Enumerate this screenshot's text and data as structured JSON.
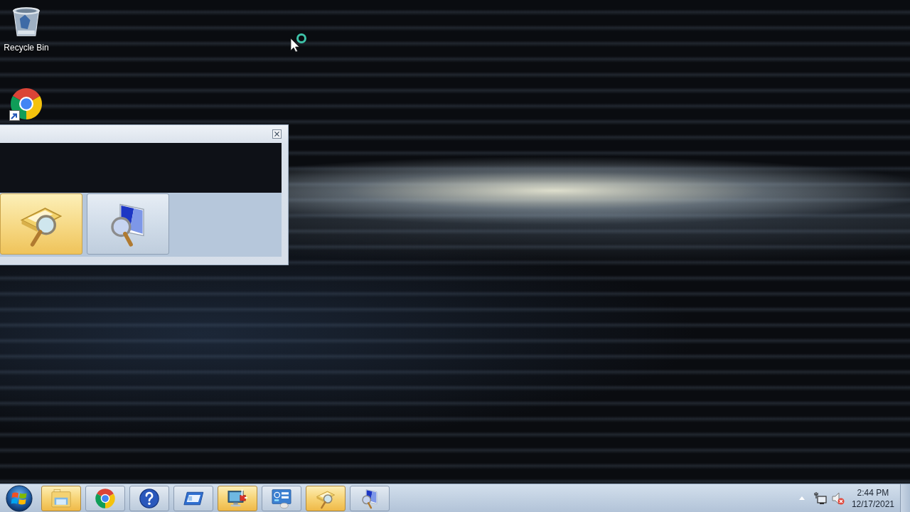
{
  "desktop": {
    "icons": [
      {
        "kind": "recycle-bin",
        "label": "Recycle Bin"
      },
      {
        "kind": "browser-shortcut"
      }
    ]
  },
  "window": {
    "tiles": [
      {
        "kind": "folder-search",
        "selected": true
      },
      {
        "kind": "monitor-search",
        "selected": false
      }
    ]
  },
  "taskbar": {
    "buttons": [
      {
        "kind": "explorer",
        "highlighted": true
      },
      {
        "kind": "browser",
        "highlighted": false
      },
      {
        "kind": "help",
        "highlighted": false
      },
      {
        "kind": "window",
        "highlighted": false
      },
      {
        "kind": "remote-desktop",
        "highlighted": true
      },
      {
        "kind": "panel",
        "highlighted": false
      },
      {
        "kind": "folder-search",
        "highlighted": true
      },
      {
        "kind": "monitor-search",
        "highlighted": false
      }
    ],
    "tray": {
      "volume_muted": true,
      "time": "2:44 PM",
      "date": "12/17/2021"
    }
  }
}
